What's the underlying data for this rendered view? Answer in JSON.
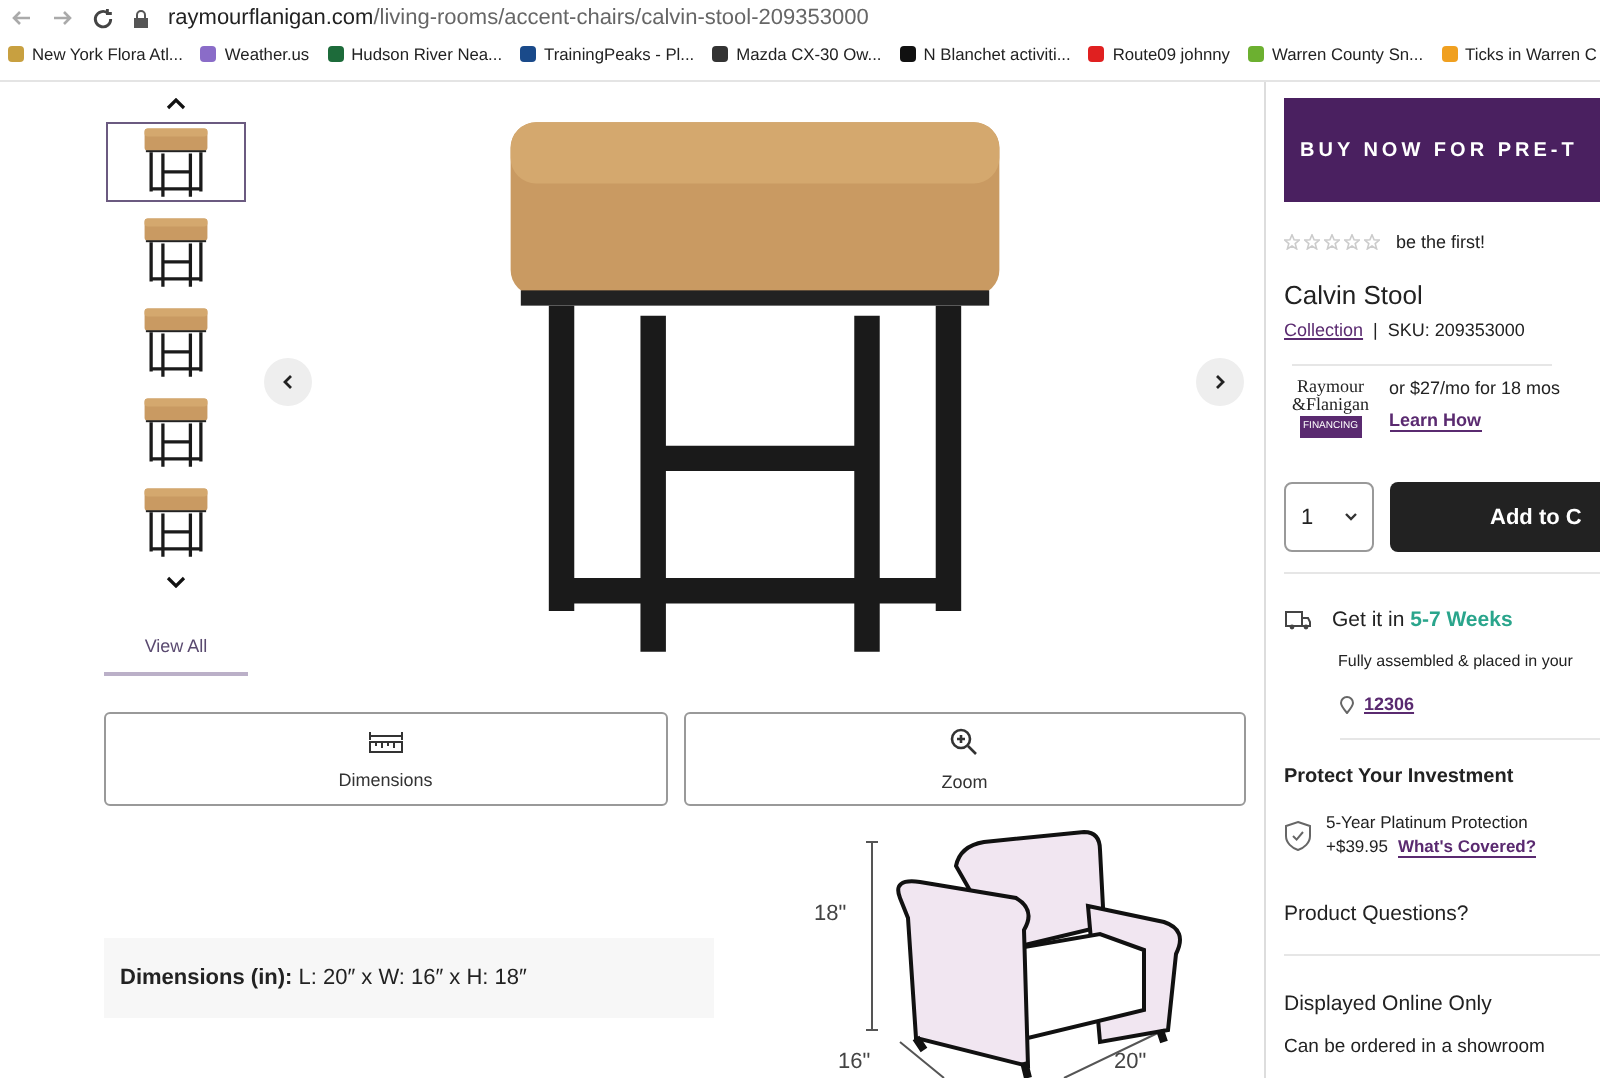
{
  "browser": {
    "url_host": "raymourflanigan.com",
    "url_path": "/living-rooms/accent-chairs/calvin-stool-209353000"
  },
  "bookmarks": [
    {
      "label": "New York Flora Atl...",
      "color": "#c8a040"
    },
    {
      "label": "Weather.us",
      "color": "#8a6cc8"
    },
    {
      "label": "Hudson River Nea...",
      "color": "#1d6b3a"
    },
    {
      "label": "TrainingPeaks - Pl...",
      "color": "#1a4a8a"
    },
    {
      "label": "Mazda CX-30 Ow...",
      "color": "#333333"
    },
    {
      "label": "N Blanchet activiti...",
      "color": "#111111"
    },
    {
      "label": "Route09 johnny",
      "color": "#e02020"
    },
    {
      "label": "Warren County Sn...",
      "color": "#6cb030"
    },
    {
      "label": "Ticks in Warren C",
      "color": "#f0a020"
    }
  ],
  "gallery": {
    "thumbnails": [
      {
        "selected": true
      },
      {
        "selected": false
      },
      {
        "selected": false
      },
      {
        "selected": false
      },
      {
        "selected": false
      }
    ],
    "view_all": "View All",
    "buttons": [
      {
        "kind": "dimensions",
        "label": "Dimensions"
      },
      {
        "kind": "zoom",
        "label": "Zoom"
      }
    ],
    "dimensions_text": "**Dimensions (in):** L: 20″ x W: 16″ x H: 18″",
    "diagram": {
      "height_label": "18\"",
      "depth_label": "16\"",
      "width_label": "20\""
    }
  },
  "product": {
    "banner": "BUY NOW FOR PRE-T",
    "stars": 0,
    "rating_text": "be the first!",
    "title": "Calvin Stool",
    "collection_link": "Collection",
    "separator": "|",
    "sku": "SKU: 209353000",
    "financing": {
      "logo_top": "Raymour",
      "logo_name": "&Flanigan",
      "logo_badge": "FINANCING",
      "offer": "or $27/mo for 18 mos",
      "link": "Learn How"
    },
    "quantity": "1",
    "add_button": "Add to C",
    "delivery": {
      "prefix": "Get it in",
      "time": "5-7 Weeks",
      "note": "Fully assembled & placed in your",
      "zip": "12306"
    },
    "protection": {
      "heading": "Protect Your Investment",
      "plan": "5-Year Platinum Protection",
      "price": "+$39.95",
      "link": "What's Covered?"
    },
    "questions": "Product Questions?",
    "availability": "Displayed Online Only",
    "showroom_note": "Can be ordered in a showroom"
  }
}
